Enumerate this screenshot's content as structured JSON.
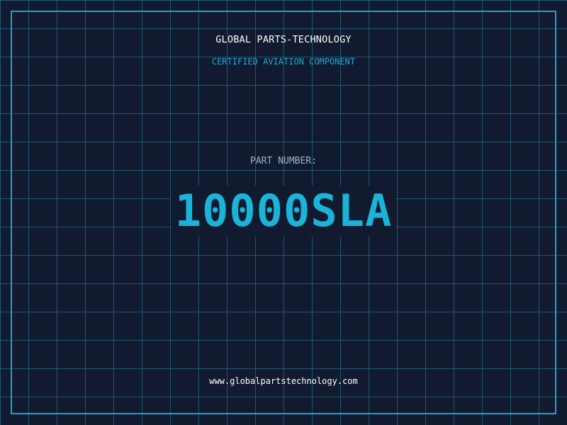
{
  "colors": {
    "background": "#121a2f",
    "grid": "#1f6c8c",
    "accent": "#19b4d8",
    "label": "#9eb3c2",
    "text": "#ffffff"
  },
  "header": {
    "company": "GLOBAL PARTS-TECHNOLOGY",
    "subtitle": "CERTIFIED AVIATION COMPONENT"
  },
  "part": {
    "label": "PART NUMBER:",
    "number": "10000SLA"
  },
  "footer": {
    "website": "www.globalpartstechnology.com"
  }
}
